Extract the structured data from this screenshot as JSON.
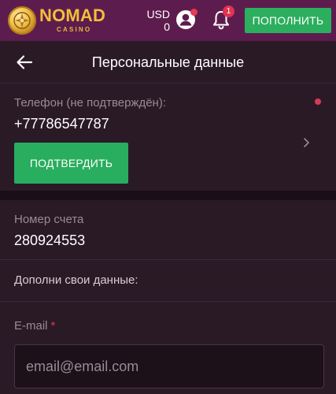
{
  "header": {
    "logo_name": "NOMAD",
    "logo_sub": "CASINO",
    "currency_code": "USD",
    "balance": "0",
    "notifications_count": "1",
    "topup_label": "ПОПОЛНИТЬ"
  },
  "page": {
    "title": "Персональные данные"
  },
  "phone": {
    "label": "Телефон (не подтверждён):",
    "value": "+77786547787",
    "confirm_label": "ПОДТВЕРДИТЬ"
  },
  "account": {
    "label": "Номер счета",
    "value": "280924553"
  },
  "complete": {
    "label": "Дополни свои данные:"
  },
  "email": {
    "label": "E-mail",
    "required_mark": "*",
    "placeholder": "email@email.com",
    "value": ""
  },
  "colors": {
    "topbar": "#5d1c4e",
    "background": "#2a1a26",
    "accent_green": "#2bae5e",
    "alert_red": "#e0344f",
    "logo_gold": "#f2bf38"
  },
  "icons": [
    "nomad-coin-logo-icon",
    "account-icon",
    "bell-icon",
    "back-arrow-icon",
    "chevron-right-icon"
  ]
}
